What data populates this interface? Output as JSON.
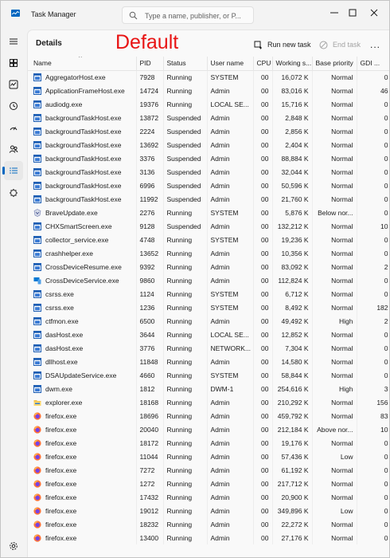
{
  "app": {
    "title": "Task Manager",
    "search_placeholder": "Type a name, publisher, or P..."
  },
  "window_controls": {
    "minimize": "—",
    "maximize": "☐",
    "close": "✕"
  },
  "page": {
    "title": "Details",
    "annotation": "Default"
  },
  "toolbar": {
    "run_new_task": "Run new task",
    "end_task": "End task",
    "more": "..."
  },
  "sidebar": {
    "items": [
      {
        "name": "hamburger-menu",
        "icon": "menu-icon"
      },
      {
        "name": "processes",
        "icon": "processes-icon"
      },
      {
        "name": "performance",
        "icon": "performance-icon"
      },
      {
        "name": "app-history",
        "icon": "history-icon"
      },
      {
        "name": "startup-apps",
        "icon": "startup-icon"
      },
      {
        "name": "users",
        "icon": "users-icon"
      },
      {
        "name": "details",
        "icon": "details-icon",
        "active": true
      },
      {
        "name": "services",
        "icon": "services-icon"
      },
      {
        "name": "settings",
        "icon": "settings-icon"
      }
    ]
  },
  "table": {
    "columns": [
      "Name",
      "PID",
      "Status",
      "User name",
      "CPU",
      "Working s...",
      "Base priority",
      "GDI ..."
    ],
    "rows": [
      {
        "icon": "generic",
        "name": "AggregatorHost.exe",
        "pid": "7928",
        "status": "Running",
        "user": "SYSTEM",
        "cpu": "00",
        "mem": "16,072 K",
        "priority": "Normal",
        "gdi": "0"
      },
      {
        "icon": "generic",
        "name": "ApplicationFrameHost.exe",
        "pid": "14724",
        "status": "Running",
        "user": "Admin",
        "cpu": "00",
        "mem": "83,016 K",
        "priority": "Normal",
        "gdi": "46"
      },
      {
        "icon": "generic",
        "name": "audiodg.exe",
        "pid": "19376",
        "status": "Running",
        "user": "LOCAL SE...",
        "cpu": "00",
        "mem": "15,716 K",
        "priority": "Normal",
        "gdi": "0"
      },
      {
        "icon": "generic",
        "name": "backgroundTaskHost.exe",
        "pid": "13872",
        "status": "Suspended",
        "user": "Admin",
        "cpu": "00",
        "mem": "2,848 K",
        "priority": "Normal",
        "gdi": "0"
      },
      {
        "icon": "generic",
        "name": "backgroundTaskHost.exe",
        "pid": "2224",
        "status": "Suspended",
        "user": "Admin",
        "cpu": "00",
        "mem": "2,856 K",
        "priority": "Normal",
        "gdi": "0"
      },
      {
        "icon": "generic",
        "name": "backgroundTaskHost.exe",
        "pid": "13692",
        "status": "Suspended",
        "user": "Admin",
        "cpu": "00",
        "mem": "2,404 K",
        "priority": "Normal",
        "gdi": "0"
      },
      {
        "icon": "generic",
        "name": "backgroundTaskHost.exe",
        "pid": "3376",
        "status": "Suspended",
        "user": "Admin",
        "cpu": "00",
        "mem": "88,884 K",
        "priority": "Normal",
        "gdi": "0"
      },
      {
        "icon": "generic",
        "name": "backgroundTaskHost.exe",
        "pid": "3136",
        "status": "Suspended",
        "user": "Admin",
        "cpu": "00",
        "mem": "32,044 K",
        "priority": "Normal",
        "gdi": "0"
      },
      {
        "icon": "generic",
        "name": "backgroundTaskHost.exe",
        "pid": "6996",
        "status": "Suspended",
        "user": "Admin",
        "cpu": "00",
        "mem": "50,596 K",
        "priority": "Normal",
        "gdi": "0"
      },
      {
        "icon": "generic",
        "name": "backgroundTaskHost.exe",
        "pid": "11992",
        "status": "Suspended",
        "user": "Admin",
        "cpu": "00",
        "mem": "21,760 K",
        "priority": "Normal",
        "gdi": "0"
      },
      {
        "icon": "brave",
        "name": "BraveUpdate.exe",
        "pid": "2276",
        "status": "Running",
        "user": "SYSTEM",
        "cpu": "00",
        "mem": "5,876 K",
        "priority": "Below nor...",
        "gdi": "0"
      },
      {
        "icon": "generic",
        "name": "CHXSmartScreen.exe",
        "pid": "9128",
        "status": "Suspended",
        "user": "Admin",
        "cpu": "00",
        "mem": "132,212 K",
        "priority": "Normal",
        "gdi": "10"
      },
      {
        "icon": "generic",
        "name": "collector_service.exe",
        "pid": "4748",
        "status": "Running",
        "user": "SYSTEM",
        "cpu": "00",
        "mem": "19,236 K",
        "priority": "Normal",
        "gdi": "0"
      },
      {
        "icon": "generic",
        "name": "crashhelper.exe",
        "pid": "13652",
        "status": "Running",
        "user": "Admin",
        "cpu": "00",
        "mem": "10,356 K",
        "priority": "Normal",
        "gdi": "0"
      },
      {
        "icon": "generic",
        "name": "CrossDeviceResume.exe",
        "pid": "9392",
        "status": "Running",
        "user": "Admin",
        "cpu": "00",
        "mem": "83,092 K",
        "priority": "Normal",
        "gdi": "2"
      },
      {
        "icon": "crossdevice",
        "name": "CrossDeviceService.exe",
        "pid": "9860",
        "status": "Running",
        "user": "Admin",
        "cpu": "00",
        "mem": "112,824 K",
        "priority": "Normal",
        "gdi": "0"
      },
      {
        "icon": "generic",
        "name": "csrss.exe",
        "pid": "1124",
        "status": "Running",
        "user": "SYSTEM",
        "cpu": "00",
        "mem": "6,712 K",
        "priority": "Normal",
        "gdi": "0"
      },
      {
        "icon": "generic",
        "name": "csrss.exe",
        "pid": "1236",
        "status": "Running",
        "user": "SYSTEM",
        "cpu": "00",
        "mem": "8,492 K",
        "priority": "Normal",
        "gdi": "182"
      },
      {
        "icon": "generic",
        "name": "ctfmon.exe",
        "pid": "6500",
        "status": "Running",
        "user": "Admin",
        "cpu": "00",
        "mem": "49,492 K",
        "priority": "High",
        "gdi": "2"
      },
      {
        "icon": "generic",
        "name": "dasHost.exe",
        "pid": "3644",
        "status": "Running",
        "user": "LOCAL SE...",
        "cpu": "00",
        "mem": "12,852 K",
        "priority": "Normal",
        "gdi": "0"
      },
      {
        "icon": "generic",
        "name": "dasHost.exe",
        "pid": "3776",
        "status": "Running",
        "user": "NETWORK...",
        "cpu": "00",
        "mem": "7,304 K",
        "priority": "Normal",
        "gdi": "0"
      },
      {
        "icon": "generic",
        "name": "dllhost.exe",
        "pid": "11848",
        "status": "Running",
        "user": "Admin",
        "cpu": "00",
        "mem": "14,580 K",
        "priority": "Normal",
        "gdi": "0"
      },
      {
        "icon": "generic",
        "name": "DSAUpdateService.exe",
        "pid": "4660",
        "status": "Running",
        "user": "SYSTEM",
        "cpu": "00",
        "mem": "58,844 K",
        "priority": "Normal",
        "gdi": "0"
      },
      {
        "icon": "generic",
        "name": "dwm.exe",
        "pid": "1812",
        "status": "Running",
        "user": "DWM-1",
        "cpu": "00",
        "mem": "254,616 K",
        "priority": "High",
        "gdi": "3"
      },
      {
        "icon": "explorer",
        "name": "explorer.exe",
        "pid": "18168",
        "status": "Running",
        "user": "Admin",
        "cpu": "00",
        "mem": "210,292 K",
        "priority": "Normal",
        "gdi": "156"
      },
      {
        "icon": "firefox",
        "name": "firefox.exe",
        "pid": "18696",
        "status": "Running",
        "user": "Admin",
        "cpu": "00",
        "mem": "459,792 K",
        "priority": "Normal",
        "gdi": "83"
      },
      {
        "icon": "firefox",
        "name": "firefox.exe",
        "pid": "20040",
        "status": "Running",
        "user": "Admin",
        "cpu": "00",
        "mem": "212,184 K",
        "priority": "Above nor...",
        "gdi": "10"
      },
      {
        "icon": "firefox",
        "name": "firefox.exe",
        "pid": "18172",
        "status": "Running",
        "user": "Admin",
        "cpu": "00",
        "mem": "19,176 K",
        "priority": "Normal",
        "gdi": "0"
      },
      {
        "icon": "firefox",
        "name": "firefox.exe",
        "pid": "11044",
        "status": "Running",
        "user": "Admin",
        "cpu": "00",
        "mem": "57,436 K",
        "priority": "Low",
        "gdi": "0"
      },
      {
        "icon": "firefox",
        "name": "firefox.exe",
        "pid": "7272",
        "status": "Running",
        "user": "Admin",
        "cpu": "00",
        "mem": "61,192 K",
        "priority": "Normal",
        "gdi": "0"
      },
      {
        "icon": "firefox",
        "name": "firefox.exe",
        "pid": "1272",
        "status": "Running",
        "user": "Admin",
        "cpu": "00",
        "mem": "217,712 K",
        "priority": "Normal",
        "gdi": "0"
      },
      {
        "icon": "firefox",
        "name": "firefox.exe",
        "pid": "17432",
        "status": "Running",
        "user": "Admin",
        "cpu": "00",
        "mem": "20,900 K",
        "priority": "Normal",
        "gdi": "0"
      },
      {
        "icon": "firefox",
        "name": "firefox.exe",
        "pid": "19012",
        "status": "Running",
        "user": "Admin",
        "cpu": "00",
        "mem": "349,896 K",
        "priority": "Low",
        "gdi": "0"
      },
      {
        "icon": "firefox",
        "name": "firefox.exe",
        "pid": "18232",
        "status": "Running",
        "user": "Admin",
        "cpu": "00",
        "mem": "22,272 K",
        "priority": "Normal",
        "gdi": "0"
      },
      {
        "icon": "firefox",
        "name": "firefox.exe",
        "pid": "13400",
        "status": "Running",
        "user": "Admin",
        "cpu": "00",
        "mem": "27,176 K",
        "priority": "Normal",
        "gdi": "0"
      }
    ]
  },
  "colors": {
    "accent": "#0067c0",
    "annotation": "#e81414",
    "generic_icon": "#1e5fb4",
    "firefox_orange": "#ff7139",
    "firefox_purple": "#7542e5"
  }
}
